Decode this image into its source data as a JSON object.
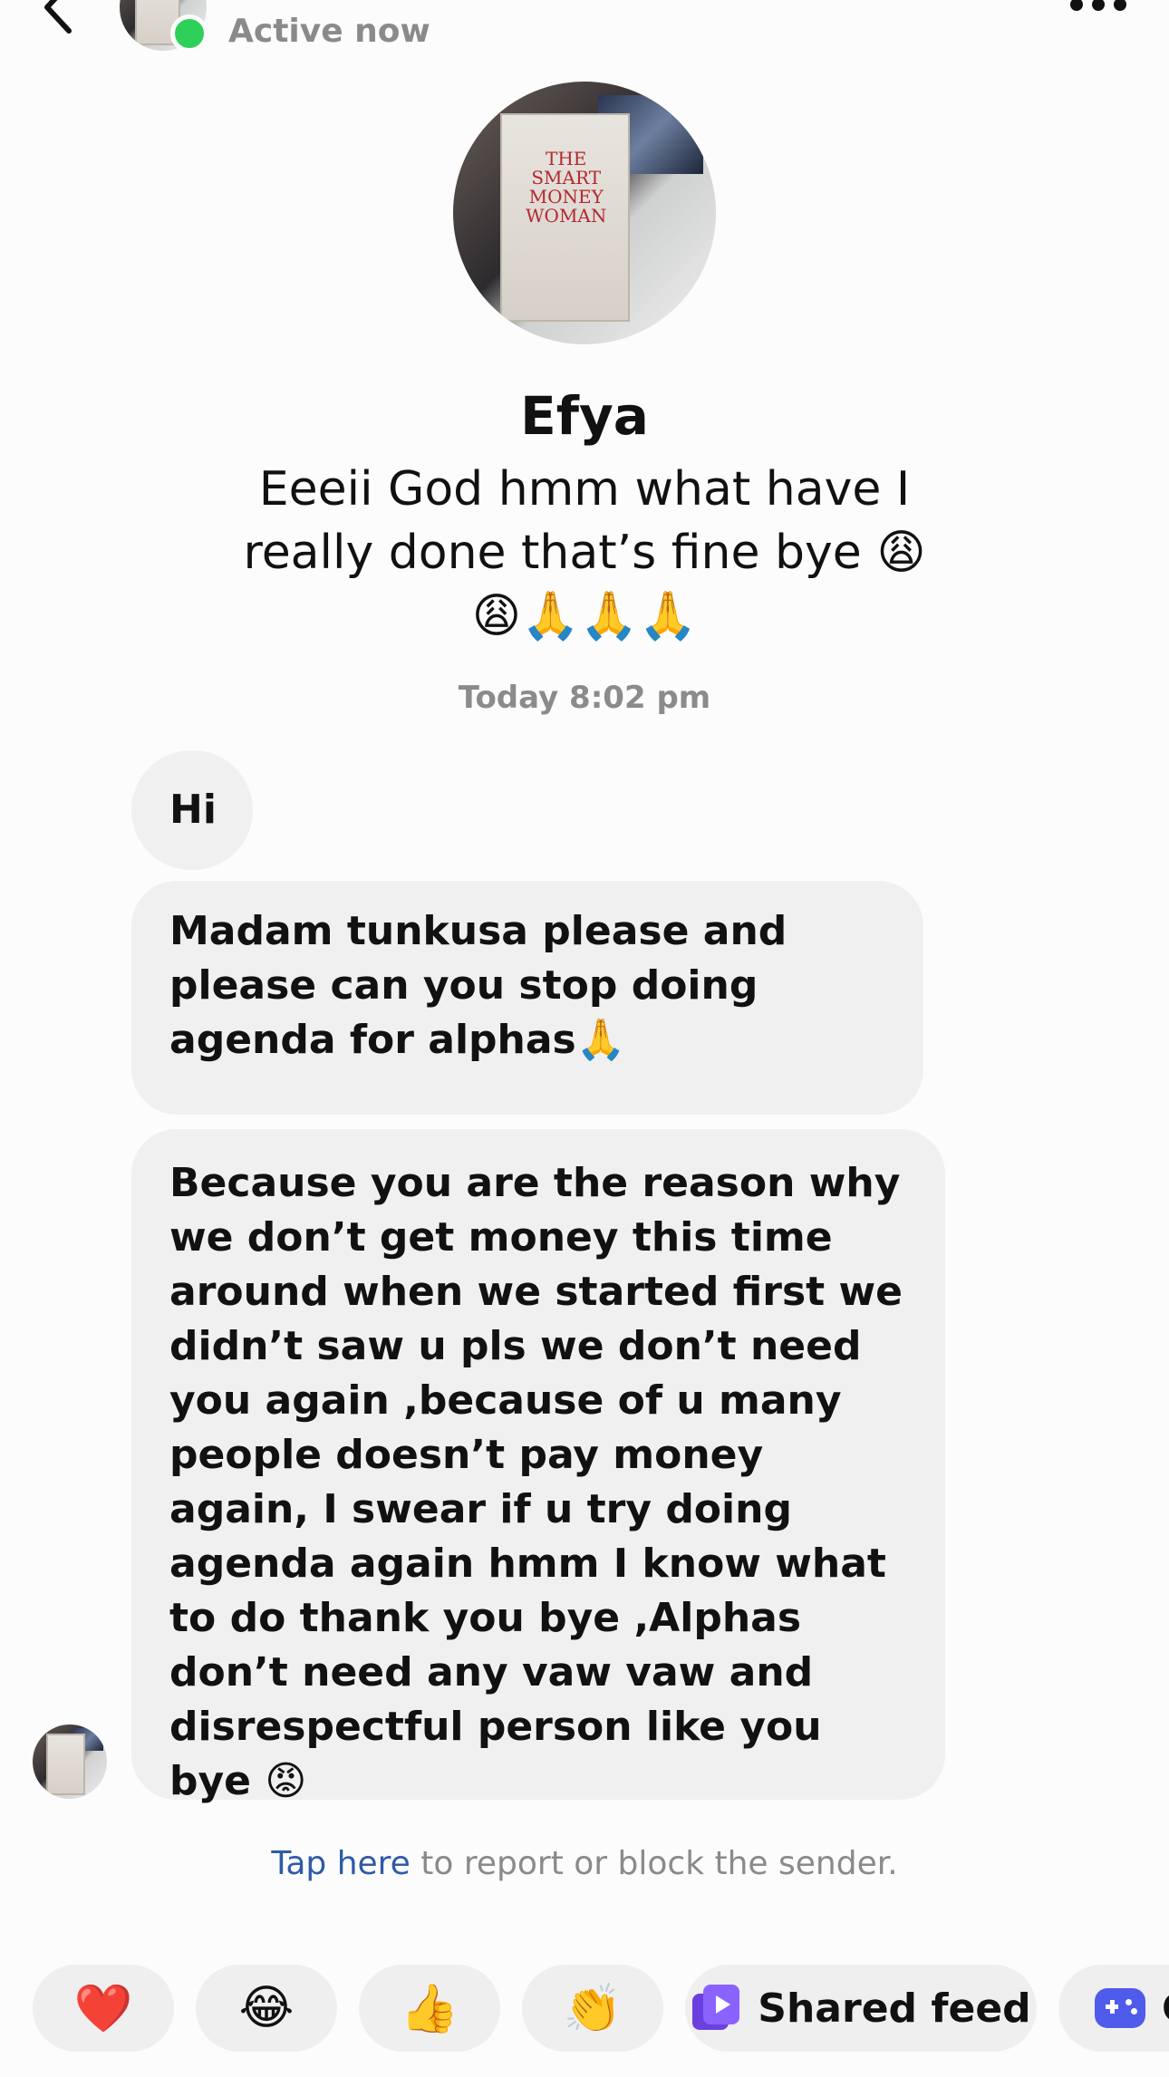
{
  "header": {
    "status": "Active now"
  },
  "profile": {
    "name": "Efya",
    "bio": "Eeeii God hmm what have I really done that’s fine bye 😩😩🙏🙏🙏",
    "avatar_book_text": "THE SMART MONEY WOMAN"
  },
  "conversation": {
    "timestamp": "Today 8:02 pm",
    "messages": [
      {
        "text": "Hi"
      },
      {
        "text": "Madam tunkusa please and please can you stop doing agenda for alphas🙏"
      },
      {
        "text": "Because you are the reason why we don’t get money this time around when we started first we didn’t saw u pls we don’t need you again ,because of u many people doesn’t pay money again, I swear if u try doing agenda again hmm I know what to do thank you bye ,Alphas don’t need any vaw vaw and disrespectful person like you bye 😡"
      }
    ]
  },
  "report": {
    "link": "Tap here",
    "rest": " to report or block the sender."
  },
  "quick_replies": [
    {
      "label": "❤️"
    },
    {
      "label": "😂"
    },
    {
      "label": "👍"
    },
    {
      "label": "👏"
    },
    {
      "label": "Shared feed"
    },
    {
      "label": "G"
    }
  ],
  "colors": {
    "online": "#2fd05a",
    "link": "#2f5aa8",
    "bubble": "#f0f0f0",
    "shared_feed_icon": "#8a63ff",
    "game_icon": "#4f5bea"
  },
  "icons": [
    "back-arrow-icon",
    "more-options-icon",
    "shared-feed-icon",
    "game-controller-icon"
  ]
}
